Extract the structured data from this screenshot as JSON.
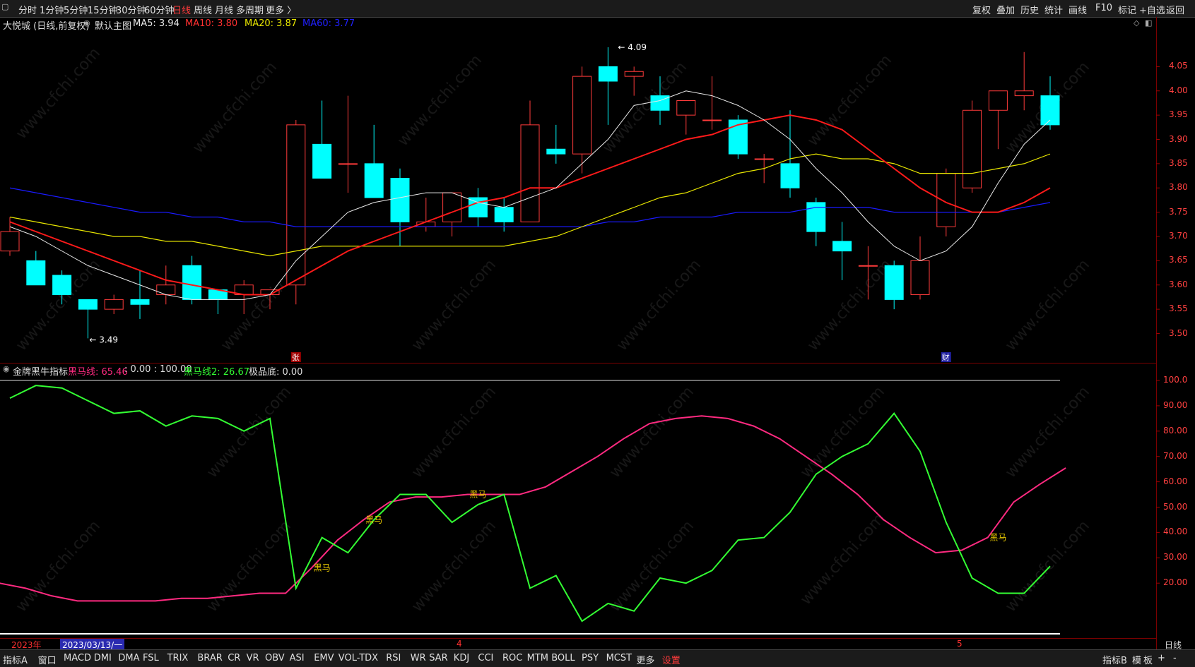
{
  "colors": {
    "up": "#ff3b3b",
    "down": "#00ffff",
    "ma5": "#e8e8e8",
    "ma10": "#ff1a1a",
    "ma20": "#e8e600",
    "ma60": "#1a1aff",
    "hm": "#ff2a80",
    "hm2": "#33ff33",
    "bg": "#000000"
  },
  "toolbar": {
    "left": [
      "分时",
      "1分钟",
      "5分钟",
      "15分钟",
      "30分钟",
      "60分钟",
      "日线",
      "周线",
      "月线",
      "多周期",
      "更多 〉"
    ],
    "active": "日线",
    "right": [
      "复权",
      "叠加",
      "历史",
      "统计",
      "画线",
      "F10",
      "标记",
      "+自选",
      "返回"
    ]
  },
  "main_header": {
    "title": "大悦城 (日线,前复权)",
    "theme": "默认主图",
    "ma5": "MA5: 3.94",
    "ma10": "MA10: 3.80",
    "ma20": "MA20: 3.87",
    "ma60": "MA60: 3.77"
  },
  "price_labels": {
    "high": "4.09",
    "low": "3.49"
  },
  "markers": {
    "zhang": "张",
    "cai": "财"
  },
  "price_axis": [
    "4.05",
    "4.00",
    "3.95",
    "3.90",
    "3.85",
    "3.80",
    "3.75",
    "3.70",
    "3.65",
    "3.60",
    "3.55",
    "3.50"
  ],
  "indicator_header": {
    "name": "金牌黑牛指标",
    "hm": "黑马线: 65.46",
    "fixed": ": 0.00 : 100.00",
    "hm2": "黑马线2: 26.67",
    "bottom": "极品底: 0.00"
  },
  "ind_axis": [
    "100.0",
    "90.00",
    "80.00",
    "70.00",
    "60.00",
    "50.00",
    "40.00",
    "30.00",
    "20.00"
  ],
  "signal_text": "黑马",
  "dates": {
    "year": "2023年",
    "cursor": "2023/03/13/一",
    "m4": "4",
    "m5": "5",
    "period": "日线"
  },
  "bottom_tabs": [
    "指标A",
    "窗口",
    "MACD",
    "DMI",
    "DMA",
    "FSL",
    "TRIX",
    "BRAR",
    "CR",
    "VR",
    "OBV",
    "ASI",
    "EMV",
    "VOL-TDX",
    "RSI",
    "WR",
    "SAR",
    "KDJ",
    "CCI",
    "ROC",
    "MTM",
    "BOLL",
    "PSY",
    "MCST",
    "更多",
    "设置"
  ],
  "bottom_right": [
    "指标B",
    "模",
    "板",
    "+",
    "-"
  ],
  "watermark": "www.cfchi.com",
  "chart_data": [
    {
      "type": "candlestick",
      "title": "大悦城 (日线,前复权)",
      "ylim": [
        3.46,
        4.1
      ],
      "candles": [
        {
          "o": 3.67,
          "h": 3.74,
          "l": 3.66,
          "c": 3.71
        },
        {
          "o": 3.65,
          "h": 3.67,
          "l": 3.61,
          "c": 3.6
        },
        {
          "o": 3.62,
          "h": 3.63,
          "l": 3.56,
          "c": 3.58
        },
        {
          "o": 3.57,
          "h": 3.57,
          "l": 3.49,
          "c": 3.55
        },
        {
          "o": 3.55,
          "h": 3.58,
          "l": 3.54,
          "c": 3.57
        },
        {
          "o": 3.57,
          "h": 3.63,
          "l": 3.53,
          "c": 3.56
        },
        {
          "o": 3.58,
          "h": 3.64,
          "l": 3.56,
          "c": 3.6
        },
        {
          "o": 3.64,
          "h": 3.66,
          "l": 3.56,
          "c": 3.57
        },
        {
          "o": 3.59,
          "h": 3.59,
          "l": 3.54,
          "c": 3.57
        },
        {
          "o": 3.58,
          "h": 3.61,
          "l": 3.54,
          "c": 3.6
        },
        {
          "o": 3.58,
          "h": 3.59,
          "l": 3.55,
          "c": 3.59
        },
        {
          "o": 3.6,
          "h": 3.94,
          "l": 3.56,
          "c": 3.93
        },
        {
          "o": 3.89,
          "h": 3.98,
          "l": 3.83,
          "c": 3.82
        },
        {
          "o": 3.85,
          "h": 3.99,
          "l": 3.79,
          "c": 3.85
        },
        {
          "o": 3.85,
          "h": 3.93,
          "l": 3.78,
          "c": 3.78
        },
        {
          "o": 3.82,
          "h": 3.84,
          "l": 3.68,
          "c": 3.73
        },
        {
          "o": 3.72,
          "h": 3.78,
          "l": 3.71,
          "c": 3.73
        },
        {
          "o": 3.73,
          "h": 3.79,
          "l": 3.7,
          "c": 3.79
        },
        {
          "o": 3.78,
          "h": 3.8,
          "l": 3.72,
          "c": 3.74
        },
        {
          "o": 3.76,
          "h": 3.78,
          "l": 3.71,
          "c": 3.73
        },
        {
          "o": 3.73,
          "h": 3.98,
          "l": 3.73,
          "c": 3.93
        },
        {
          "o": 3.88,
          "h": 3.93,
          "l": 3.85,
          "c": 3.87
        },
        {
          "o": 3.87,
          "h": 4.05,
          "l": 3.83,
          "c": 4.03
        },
        {
          "o": 4.05,
          "h": 4.09,
          "l": 3.93,
          "c": 4.02
        },
        {
          "o": 4.03,
          "h": 4.05,
          "l": 3.99,
          "c": 4.04
        },
        {
          "o": 3.99,
          "h": 4.03,
          "l": 3.93,
          "c": 3.96
        },
        {
          "o": 3.95,
          "h": 3.98,
          "l": 3.91,
          "c": 3.98
        },
        {
          "o": 3.94,
          "h": 4.03,
          "l": 3.92,
          "c": 3.94
        },
        {
          "o": 3.94,
          "h": 3.95,
          "l": 3.86,
          "c": 3.87
        },
        {
          "o": 3.86,
          "h": 3.87,
          "l": 3.81,
          "c": 3.86
        },
        {
          "o": 3.85,
          "h": 3.96,
          "l": 3.78,
          "c": 3.8
        },
        {
          "o": 3.77,
          "h": 3.78,
          "l": 3.68,
          "c": 3.71
        },
        {
          "o": 3.69,
          "h": 3.73,
          "l": 3.61,
          "c": 3.67
        },
        {
          "o": 3.64,
          "h": 3.68,
          "l": 3.57,
          "c": 3.64
        },
        {
          "o": 3.64,
          "h": 3.65,
          "l": 3.55,
          "c": 3.57
        },
        {
          "o": 3.58,
          "h": 3.7,
          "l": 3.57,
          "c": 3.65
        },
        {
          "o": 3.72,
          "h": 3.84,
          "l": 3.7,
          "c": 3.83
        },
        {
          "o": 3.8,
          "h": 3.98,
          "l": 3.79,
          "c": 3.96
        },
        {
          "o": 3.96,
          "h": 4.0,
          "l": 3.88,
          "c": 4.0
        },
        {
          "o": 3.99,
          "h": 4.08,
          "l": 3.96,
          "c": 4.0
        },
        {
          "o": 3.99,
          "h": 4.03,
          "l": 3.92,
          "c": 3.93
        }
      ],
      "ma5": [
        3.72,
        3.7,
        3.67,
        3.64,
        3.62,
        3.6,
        3.58,
        3.57,
        3.57,
        3.57,
        3.58,
        3.65,
        3.7,
        3.75,
        3.77,
        3.78,
        3.79,
        3.79,
        3.77,
        3.76,
        3.78,
        3.8,
        3.85,
        3.9,
        3.97,
        3.98,
        4.0,
        3.99,
        3.97,
        3.94,
        3.9,
        3.84,
        3.79,
        3.73,
        3.68,
        3.65,
        3.67,
        3.72,
        3.81,
        3.89,
        3.94
      ],
      "ma10": [
        3.73,
        3.71,
        3.69,
        3.67,
        3.65,
        3.63,
        3.61,
        3.6,
        3.59,
        3.58,
        3.58,
        3.61,
        3.64,
        3.67,
        3.69,
        3.71,
        3.73,
        3.75,
        3.77,
        3.78,
        3.8,
        3.8,
        3.82,
        3.84,
        3.86,
        3.88,
        3.9,
        3.91,
        3.93,
        3.94,
        3.95,
        3.94,
        3.92,
        3.88,
        3.84,
        3.8,
        3.77,
        3.75,
        3.75,
        3.77,
        3.8
      ],
      "ma20": [
        3.74,
        3.73,
        3.72,
        3.71,
        3.7,
        3.7,
        3.69,
        3.69,
        3.68,
        3.67,
        3.66,
        3.67,
        3.68,
        3.68,
        3.68,
        3.68,
        3.68,
        3.68,
        3.68,
        3.68,
        3.69,
        3.7,
        3.72,
        3.74,
        3.76,
        3.78,
        3.79,
        3.81,
        3.83,
        3.84,
        3.86,
        3.87,
        3.86,
        3.86,
        3.85,
        3.83,
        3.83,
        3.83,
        3.84,
        3.85,
        3.87
      ],
      "ma60": [
        3.8,
        3.79,
        3.78,
        3.77,
        3.76,
        3.75,
        3.75,
        3.74,
        3.74,
        3.73,
        3.73,
        3.72,
        3.72,
        3.72,
        3.72,
        3.72,
        3.72,
        3.72,
        3.72,
        3.72,
        3.72,
        3.72,
        3.72,
        3.73,
        3.73,
        3.74,
        3.74,
        3.74,
        3.75,
        3.75,
        3.75,
        3.76,
        3.76,
        3.76,
        3.75,
        3.75,
        3.75,
        3.75,
        3.75,
        3.76,
        3.77
      ]
    },
    {
      "type": "line",
      "title": "金牌黑牛指标",
      "ylim": [
        0,
        100
      ],
      "series": [
        {
          "name": "黑马线",
          "values": [
            20,
            18,
            15,
            13,
            13,
            13,
            13,
            14,
            14,
            15,
            16,
            16,
            26,
            37,
            45,
            52,
            54,
            54,
            55,
            55,
            55,
            58,
            64,
            70,
            77,
            83,
            85,
            86,
            85,
            82,
            77,
            70,
            63,
            55,
            45,
            38,
            32,
            33,
            38,
            52,
            59,
            65.46
          ]
        },
        {
          "name": "黑马线2",
          "values": [
            93,
            98,
            97,
            92,
            87,
            88,
            82,
            86,
            85,
            80,
            85,
            18,
            38,
            32,
            45,
            55,
            55,
            44,
            51,
            55,
            18,
            23,
            5,
            12,
            9,
            22,
            20,
            25,
            37,
            38,
            48,
            63,
            70,
            75,
            87,
            72,
            44,
            22,
            16,
            16,
            26.67
          ]
        }
      ],
      "signals": [
        12,
        14,
        18,
        38
      ]
    }
  ]
}
